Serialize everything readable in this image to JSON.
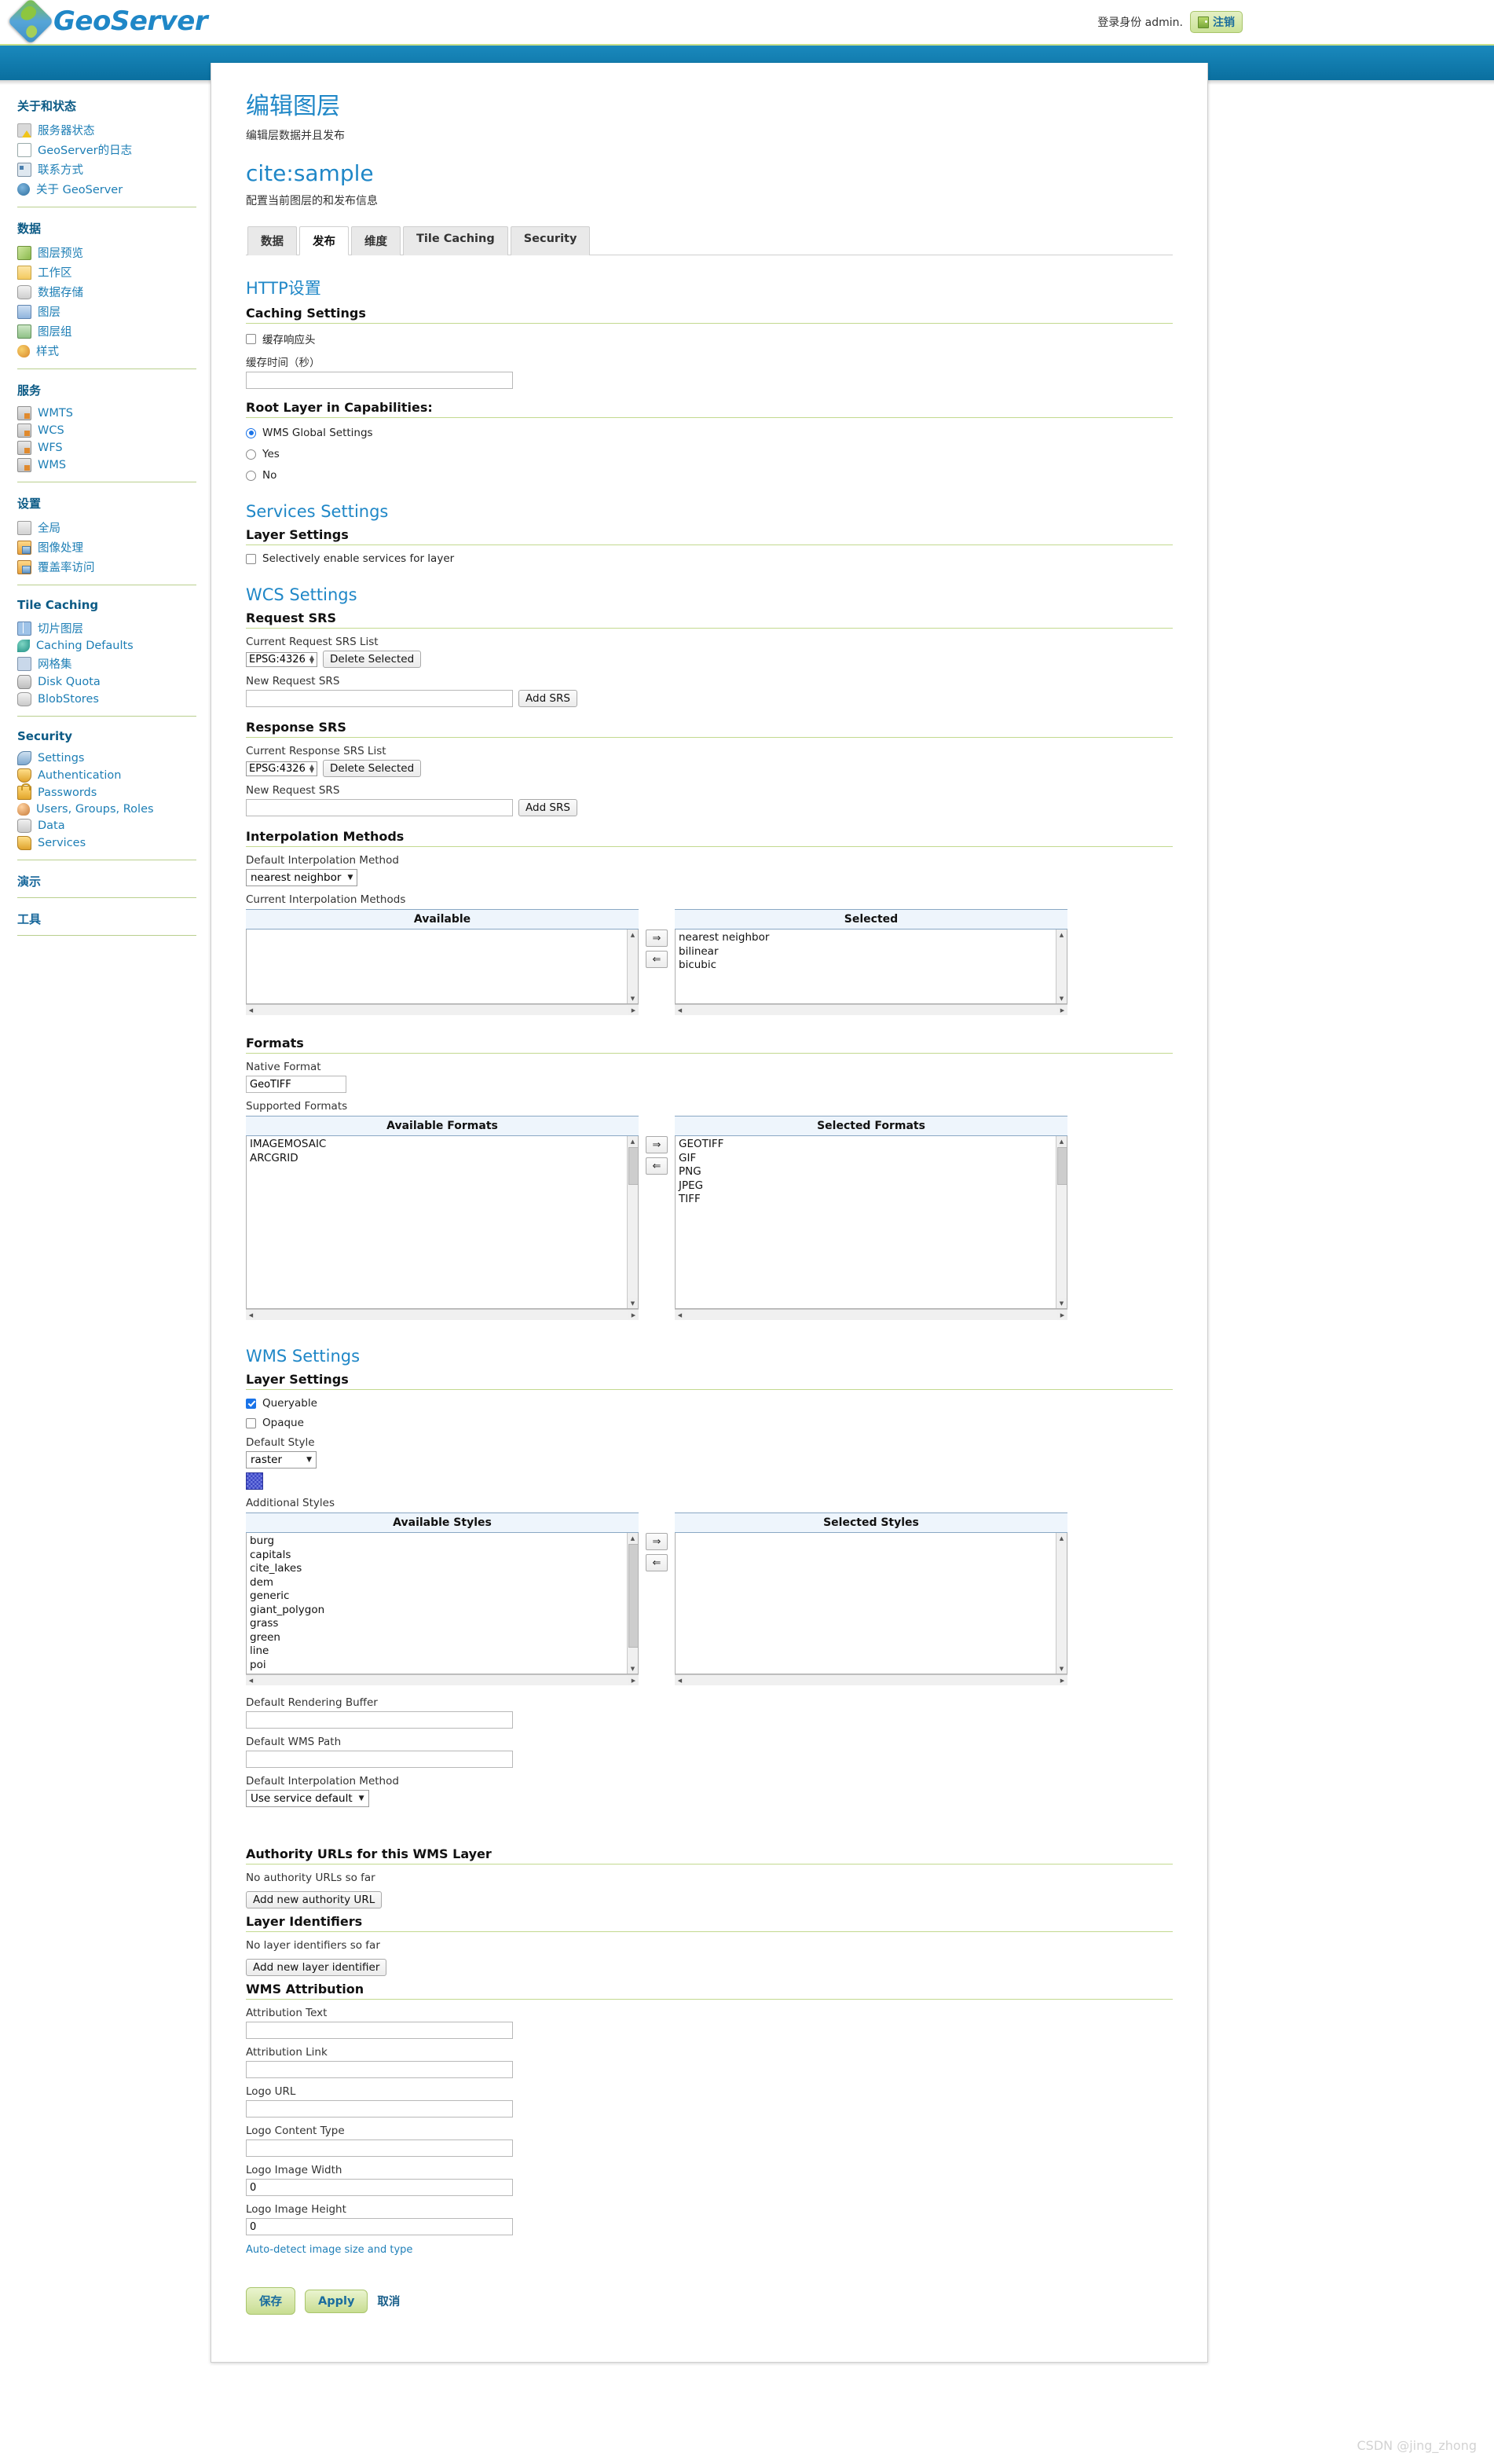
{
  "header": {
    "brand": "GeoServer",
    "login_text": "登录身份 admin.",
    "logout_label": "注销"
  },
  "sidebar": {
    "groups": [
      {
        "title": "关于和状态",
        "items": [
          {
            "label": "服务器状态",
            "icon": "status-icon"
          },
          {
            "label": "GeoServer的日志",
            "icon": "document-icon"
          },
          {
            "label": "联系方式",
            "icon": "contact-card-icon"
          },
          {
            "label": "关于 GeoServer",
            "icon": "about-icon"
          }
        ]
      },
      {
        "title": "数据",
        "items": [
          {
            "label": "图层预览",
            "icon": "layer-preview-icon"
          },
          {
            "label": "工作区",
            "icon": "folder-icon"
          },
          {
            "label": "数据存储",
            "icon": "datastore-icon"
          },
          {
            "label": "图层",
            "icon": "layer-icon"
          },
          {
            "label": "图层组",
            "icon": "layergroup-icon"
          },
          {
            "label": "样式",
            "icon": "palette-icon"
          }
        ]
      },
      {
        "title": "服务",
        "items": [
          {
            "label": "WMTS",
            "icon": "service-icon"
          },
          {
            "label": "WCS",
            "icon": "service-icon"
          },
          {
            "label": "WFS",
            "icon": "service-icon"
          },
          {
            "label": "WMS",
            "icon": "service-icon"
          }
        ]
      },
      {
        "title": "设置",
        "items": [
          {
            "label": "全局",
            "icon": "global-icon"
          },
          {
            "label": "图像处理",
            "icon": "image-processing-icon"
          },
          {
            "label": "覆盖率访问",
            "icon": "coverage-access-icon"
          }
        ]
      },
      {
        "title": "Tile Caching",
        "items": [
          {
            "label": "切片图层",
            "icon": "tile-layer-icon"
          },
          {
            "label": "Caching Defaults",
            "icon": "caching-defaults-icon"
          },
          {
            "label": "网格集",
            "icon": "gridset-icon"
          },
          {
            "label": "Disk Quota",
            "icon": "disk-icon"
          },
          {
            "label": "BlobStores",
            "icon": "blobstore-icon"
          }
        ]
      },
      {
        "title": "Security",
        "items": [
          {
            "label": "Settings",
            "icon": "settings-icon"
          },
          {
            "label": "Authentication",
            "icon": "shield-icon"
          },
          {
            "label": "Passwords",
            "icon": "lock-icon"
          },
          {
            "label": "Users, Groups, Roles",
            "icon": "users-icon"
          },
          {
            "label": "Data",
            "icon": "data-icon"
          },
          {
            "label": "Services",
            "icon": "services-icon"
          }
        ]
      },
      {
        "title": "演示",
        "items": []
      },
      {
        "title": "工具",
        "items": []
      }
    ]
  },
  "page": {
    "title": "编辑图层",
    "subtitle": "编辑层数据并且发布",
    "layer_name": "cite:sample",
    "layer_subtitle": "配置当前图层的和发布信息",
    "tabs": [
      {
        "label": "数据",
        "active": false
      },
      {
        "label": "发布",
        "active": true
      },
      {
        "label": "维度",
        "active": false
      },
      {
        "label": "Tile Caching",
        "active": false
      },
      {
        "label": "Security",
        "active": false
      }
    ]
  },
  "http_settings": {
    "heading": "HTTP设置",
    "caching_heading": "Caching Settings",
    "response_headers_label": "缓存响应头",
    "response_headers_checked": false,
    "cache_time_label": "缓存时间（秒）",
    "cache_time_value": "",
    "root_layer_heading": "Root Layer in Capabilities:",
    "root_layer_options": [
      {
        "label": "WMS Global Settings",
        "selected": true
      },
      {
        "label": "Yes",
        "selected": false
      },
      {
        "label": "No",
        "selected": false
      }
    ]
  },
  "services_settings": {
    "heading": "Services Settings",
    "layer_settings_heading": "Layer Settings",
    "selective_label": "Selectively enable services for layer",
    "selective_checked": false
  },
  "wcs_settings": {
    "heading": "WCS Settings",
    "request_srs": {
      "heading": "Request SRS",
      "current_label": "Current Request SRS List",
      "current_value": "EPSG:4326",
      "delete_label": "Delete Selected",
      "new_label": "New Request SRS",
      "new_value": "",
      "add_label": "Add SRS"
    },
    "response_srs": {
      "heading": "Response SRS",
      "current_label": "Current Response SRS List",
      "current_value": "EPSG:4326",
      "delete_label": "Delete Selected",
      "new_label": "New Request SRS",
      "new_value": "",
      "add_label": "Add SRS"
    },
    "interpolation": {
      "heading": "Interpolation Methods",
      "default_label": "Default Interpolation Method",
      "default_value": "nearest neighbor",
      "current_label": "Current Interpolation Methods",
      "available_header": "Available",
      "selected_header": "Selected",
      "available": [],
      "selected": [
        "nearest neighbor",
        "bilinear",
        "bicubic"
      ],
      "add_icon": "arrow-right-icon",
      "remove_icon": "arrow-left-icon"
    },
    "formats": {
      "heading": "Formats",
      "native_label": "Native Format",
      "native_value": "GeoTIFF",
      "supported_label": "Supported Formats",
      "available_header": "Available Formats",
      "selected_header": "Selected Formats",
      "available": [
        "IMAGEMOSAIC",
        "ARCGRID"
      ],
      "selected": [
        "GEOTIFF",
        "GIF",
        "PNG",
        "JPEG",
        "TIFF"
      ]
    }
  },
  "wms_settings": {
    "heading": "WMS Settings",
    "layer_settings_heading": "Layer Settings",
    "queryable_label": "Queryable",
    "queryable_checked": true,
    "opaque_label": "Opaque",
    "opaque_checked": false,
    "default_style_label": "Default Style",
    "default_style_value": "raster",
    "additional_styles_label": "Additional Styles",
    "available_header": "Available Styles",
    "selected_header": "Selected Styles",
    "available_styles": [
      "burg",
      "capitals",
      "cite_lakes",
      "dem",
      "generic",
      "giant_polygon",
      "grass",
      "green",
      "line",
      "poi"
    ],
    "selected_styles": [],
    "rendering_buffer_label": "Default Rendering Buffer",
    "rendering_buffer_value": "",
    "wms_path_label": "Default WMS Path",
    "wms_path_value": "",
    "interpolation_label": "Default Interpolation Method",
    "interpolation_value": "Use service default"
  },
  "authority_urls": {
    "heading": "Authority URLs for this WMS Layer",
    "empty_text": "No authority URLs so far",
    "add_label": "Add new authority URL"
  },
  "layer_identifiers": {
    "heading": "Layer Identifiers",
    "empty_text": "No layer identifiers so far",
    "add_label": "Add new layer identifier"
  },
  "wms_attribution": {
    "heading": "WMS Attribution",
    "fields": [
      {
        "label": "Attribution Text",
        "value": ""
      },
      {
        "label": "Attribution Link",
        "value": ""
      },
      {
        "label": "Logo URL",
        "value": ""
      },
      {
        "label": "Logo Content Type",
        "value": ""
      },
      {
        "label": "Logo Image Width",
        "value": "0"
      },
      {
        "label": "Logo Image Height",
        "value": "0"
      }
    ],
    "autodetect_label": "Auto-detect image size and type"
  },
  "actions": {
    "save_label": "保存",
    "apply_label": "Apply",
    "cancel_label": "取消"
  },
  "watermark": "CSDN @jing_zhong"
}
